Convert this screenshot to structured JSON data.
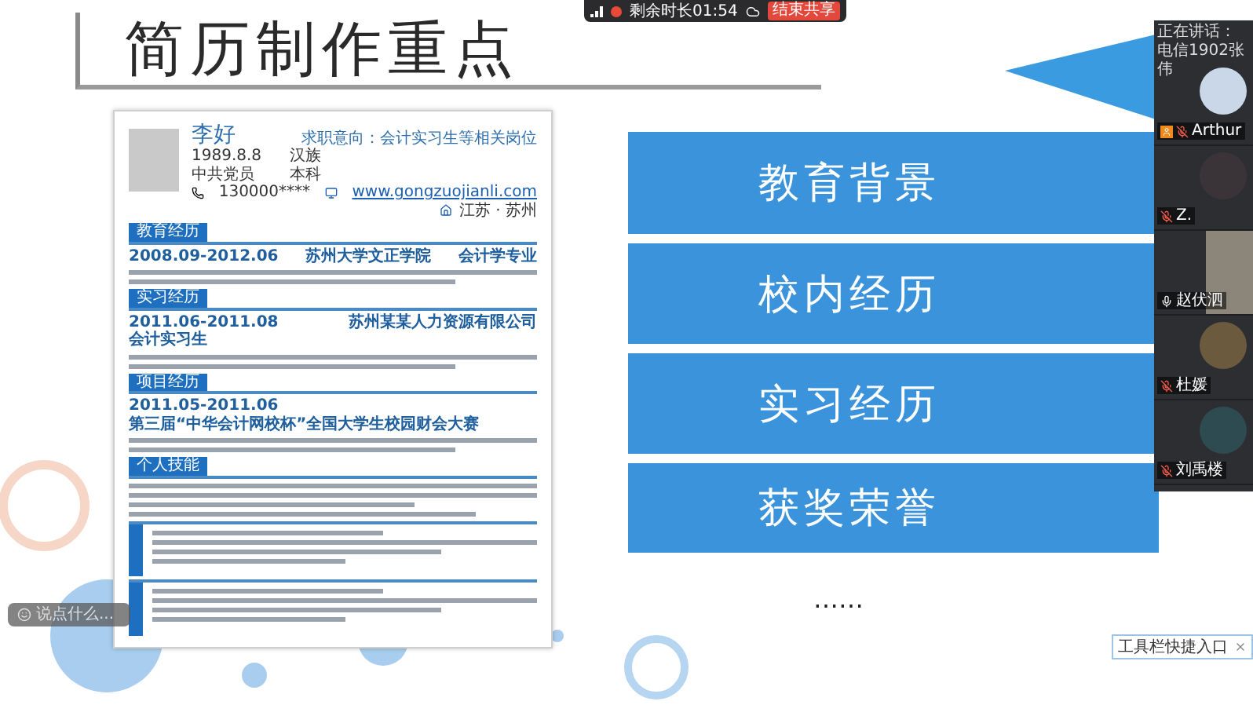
{
  "slide": {
    "title": "简历制作重点",
    "resume": {
      "name": "李好",
      "objective_label": "求职意向：",
      "objective": "会计实习生等相关岗位",
      "birth": "1989.8.8",
      "ethnicity": "汉族",
      "politics": "中共党员",
      "degree": "本科",
      "phone": "130000****",
      "website": "www.gongzuojianli.com",
      "location": "江苏 · 苏州",
      "sections": [
        {
          "kind": "entry",
          "heading": "教育经历",
          "date": "2008.09-2012.06",
          "org": "苏州大学文正学院",
          "role": "会计学专业"
        },
        {
          "kind": "entry",
          "heading": "实习经历",
          "date": "2011.06-2011.08",
          "org": "苏州某某人力资源有限公司",
          "role": "会计实习生"
        },
        {
          "kind": "entry",
          "heading": "项目经历",
          "date": "2011.05-2011.06",
          "org": "第三届“中华会计网校杯”全国大学生校园财会大赛"
        },
        {
          "kind": "skills",
          "heading": "个人技能"
        },
        {
          "kind": "side"
        },
        {
          "kind": "side"
        }
      ]
    },
    "topics": [
      {
        "label": "教育背景"
      },
      {
        "label": "校内经历"
      },
      {
        "label": "实习经历"
      },
      {
        "label": "获奖荣誉"
      }
    ],
    "ellipsis": "……"
  },
  "meeting": {
    "top_bar": {
      "remaining": "剩余时长01:54",
      "end_button": "结束共享"
    },
    "speaking_label": "正在讲话：",
    "speaker": "电信1902张伟",
    "participants": [
      {
        "kind": "avatar",
        "name": "Arthur",
        "muted": true,
        "host": true
      },
      {
        "kind": "avatar",
        "name": "Z.",
        "muted": true,
        "host": false
      },
      {
        "kind": "video",
        "name": "赵伏泗",
        "muted": false,
        "host": false
      },
      {
        "kind": "avatar",
        "name": "杜媛",
        "muted": true,
        "host": false
      },
      {
        "kind": "avatar",
        "name": "刘禹楼",
        "muted": true,
        "host": false
      }
    ]
  },
  "chat": {
    "placeholder": "说点什么..."
  },
  "tooltip": {
    "label": "工具栏快捷入口"
  }
}
